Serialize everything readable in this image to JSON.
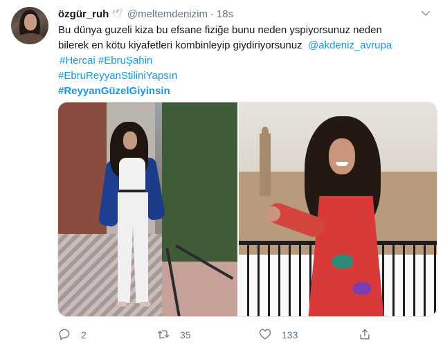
{
  "tweet": {
    "display_name": "özgür_ruh",
    "handle": "@meltemdenizim",
    "dot": "·",
    "time": "18s",
    "text_line1": "Bu dünya guzeli kiza bu efsane fiziğe bunu neden yspiyorsunuz neden",
    "text_line2_plain": "bilerek en kötu kiyafetleri kombinleyip giydiriyorsunuz ",
    "mention": "@akdeniz_avrupa",
    "hashtag_hercai": "#Hercai",
    "hashtag_ebru": "#EbruŞahin",
    "hashtag_stil": "#EbruReyyanStiliniYapsın",
    "hashtag_reyyan": "#ReyyanGüzelGiyinsin"
  },
  "actions": {
    "reply_count": "2",
    "retweet_count": "35",
    "like_count": "133"
  },
  "icons": {
    "avatar": "avatar",
    "bird": "bird-icon",
    "more": "chevron-down-icon",
    "reply": "reply-icon",
    "retweet": "retweet-icon",
    "like": "heart-icon",
    "share": "share-icon"
  },
  "colors": {
    "link": "#1b95e0",
    "muted": "#657786",
    "text": "#14171a"
  }
}
